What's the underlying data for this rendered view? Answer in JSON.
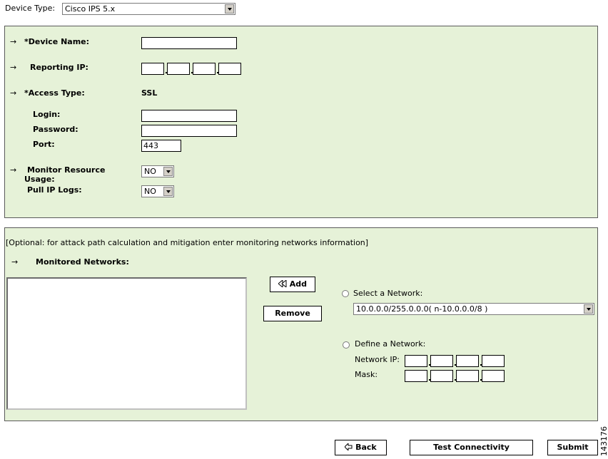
{
  "device_type": {
    "label": "Device Type:",
    "selected": "Cisco IPS 5.x"
  },
  "main_panel": {
    "device_name_label": "*Device Name:",
    "reporting_ip_label": "Reporting IP:",
    "access_type_label": "*Access Type:",
    "access_type_value": "SSL",
    "login_label": "Login:",
    "password_label": "Password:",
    "port_label": "Port:",
    "port_value": "443",
    "monitor_resource_label_1": "Monitor Resource",
    "monitor_resource_label_2": "Usage:",
    "monitor_resource_value": "NO",
    "pull_ip_logs_label": "Pull IP Logs:",
    "pull_ip_logs_value": "NO"
  },
  "networks_panel": {
    "optional_note": "[Optional: for attack path calculation and mitigation enter monitoring networks information]",
    "monitored_networks_label": "Monitored Networks:",
    "add_button": "Add",
    "remove_button": "Remove",
    "select_network_label": "Select a Network:",
    "select_network_value": "10.0.0.0/255.0.0.0( n-10.0.0.0/8 )",
    "define_network_label": "Define a Network:",
    "network_ip_label": "Network IP:",
    "mask_label": "Mask:"
  },
  "footer": {
    "back_button": "Back",
    "test_connectivity_button": "Test Connectivity",
    "submit_button": "Submit"
  },
  "figure_number": "143176",
  "icons": {
    "row_arrow": "→",
    "back_arrow": "back-arrow-icon",
    "add_arrow": "add-arrow-icon"
  },
  "colors": {
    "panel_background": "#e6f2d8",
    "panel_border": "#5a5a5a"
  }
}
